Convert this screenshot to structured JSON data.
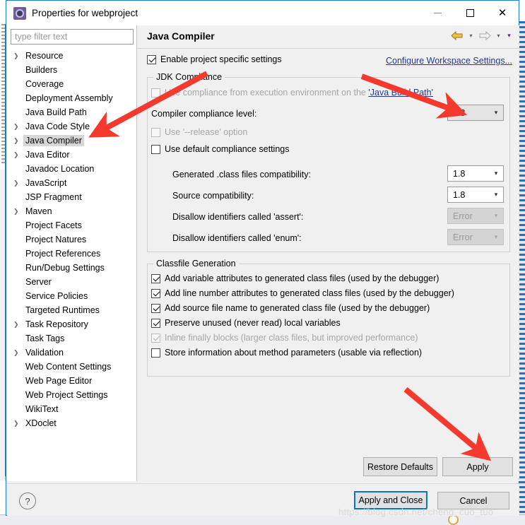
{
  "window": {
    "title": "Properties for webproject",
    "icon": "eclipse-properties-icon",
    "minimize_label": "–",
    "maximize_label": "",
    "close_label": "✕"
  },
  "sidebar": {
    "filter_placeholder": "type filter text",
    "items": [
      {
        "label": "Resource",
        "expandable": true,
        "selected": false
      },
      {
        "label": "Builders",
        "expandable": false,
        "selected": false
      },
      {
        "label": "Coverage",
        "expandable": false,
        "selected": false
      },
      {
        "label": "Deployment Assembly",
        "expandable": false,
        "selected": false
      },
      {
        "label": "Java Build Path",
        "expandable": false,
        "selected": false
      },
      {
        "label": "Java Code Style",
        "expandable": true,
        "selected": false
      },
      {
        "label": "Java Compiler",
        "expandable": true,
        "selected": true
      },
      {
        "label": "Java Editor",
        "expandable": true,
        "selected": false
      },
      {
        "label": "Javadoc Location",
        "expandable": false,
        "selected": false
      },
      {
        "label": "JavaScript",
        "expandable": true,
        "selected": false
      },
      {
        "label": "JSP Fragment",
        "expandable": false,
        "selected": false
      },
      {
        "label": "Maven",
        "expandable": true,
        "selected": false
      },
      {
        "label": "Project Facets",
        "expandable": false,
        "selected": false
      },
      {
        "label": "Project Natures",
        "expandable": false,
        "selected": false
      },
      {
        "label": "Project References",
        "expandable": false,
        "selected": false
      },
      {
        "label": "Run/Debug Settings",
        "expandable": false,
        "selected": false
      },
      {
        "label": "Server",
        "expandable": false,
        "selected": false
      },
      {
        "label": "Service Policies",
        "expandable": false,
        "selected": false
      },
      {
        "label": "Targeted Runtimes",
        "expandable": false,
        "selected": false
      },
      {
        "label": "Task Repository",
        "expandable": true,
        "selected": false
      },
      {
        "label": "Task Tags",
        "expandable": false,
        "selected": false
      },
      {
        "label": "Validation",
        "expandable": true,
        "selected": false
      },
      {
        "label": "Web Content Settings",
        "expandable": false,
        "selected": false
      },
      {
        "label": "Web Page Editor",
        "expandable": false,
        "selected": false
      },
      {
        "label": "Web Project Settings",
        "expandable": false,
        "selected": false
      },
      {
        "label": "WikiText",
        "expandable": false,
        "selected": false
      },
      {
        "label": "XDoclet",
        "expandable": true,
        "selected": false
      }
    ]
  },
  "page": {
    "title": "Java Compiler",
    "nav": {
      "back_icon": "back-arrow-icon",
      "back_caret": "▾",
      "forward_icon": "forward-arrow-icon",
      "forward_caret": "▾",
      "menu_caret": "▾"
    },
    "enable_specific": {
      "label": "Enable project specific settings",
      "checked": true
    },
    "configure_workspace_link": "Configure Workspace Settings...",
    "jdk_compliance": {
      "group_title": "JDK Compliance",
      "use_execution_env": {
        "prefix": "U",
        "label": "se compliance from execution environment on the ",
        "link": "'Java Build Path'",
        "checked": false,
        "disabled": true
      },
      "compliance_level_label": "Compiler compliance level:",
      "compliance_level_value": "1.8",
      "use_release": {
        "label": "Use '--release' option",
        "checked": false,
        "disabled": true
      },
      "use_default": {
        "label": "Use default compliance settings",
        "checked": false,
        "disabled": false
      },
      "rows": [
        {
          "label": "Generated .class files compatibility:",
          "value": "1.8",
          "disabled": false
        },
        {
          "label": "Source compatibility:",
          "value": "1.8",
          "disabled": false
        },
        {
          "label": "Disallow identifiers called 'assert':",
          "value": "Error",
          "disabled": true
        },
        {
          "label": "Disallow identifiers called 'enum':",
          "value": "Error",
          "disabled": true
        }
      ]
    },
    "classfile_generation": {
      "group_title": "Classfile Generation",
      "options": [
        {
          "label": "Add variable attributes to generated class files (used by the debugger)",
          "checked": true,
          "disabled": false
        },
        {
          "label": "Add line number attributes to generated class files (used by the debugger)",
          "checked": true,
          "disabled": false
        },
        {
          "label": "Add source file name to generated class file (used by the debugger)",
          "checked": true,
          "disabled": false
        },
        {
          "label": "Preserve unused (never read) local variables",
          "checked": true,
          "disabled": false
        },
        {
          "label": "Inline finally blocks (larger class files, but improved performance)",
          "checked": true,
          "disabled": true
        },
        {
          "label": "Store information about method parameters (usable via reflection)",
          "checked": false,
          "disabled": false
        }
      ]
    }
  },
  "buttons": {
    "restore_defaults": "Restore Defaults",
    "apply": "Apply",
    "apply_and_close": "Apply and Close",
    "cancel": "Cancel",
    "help": "?"
  },
  "annotations": {
    "watermark": "https://blog.csdn.net/cheng_cuo_tuo",
    "arrow_color": "#f4392f"
  }
}
